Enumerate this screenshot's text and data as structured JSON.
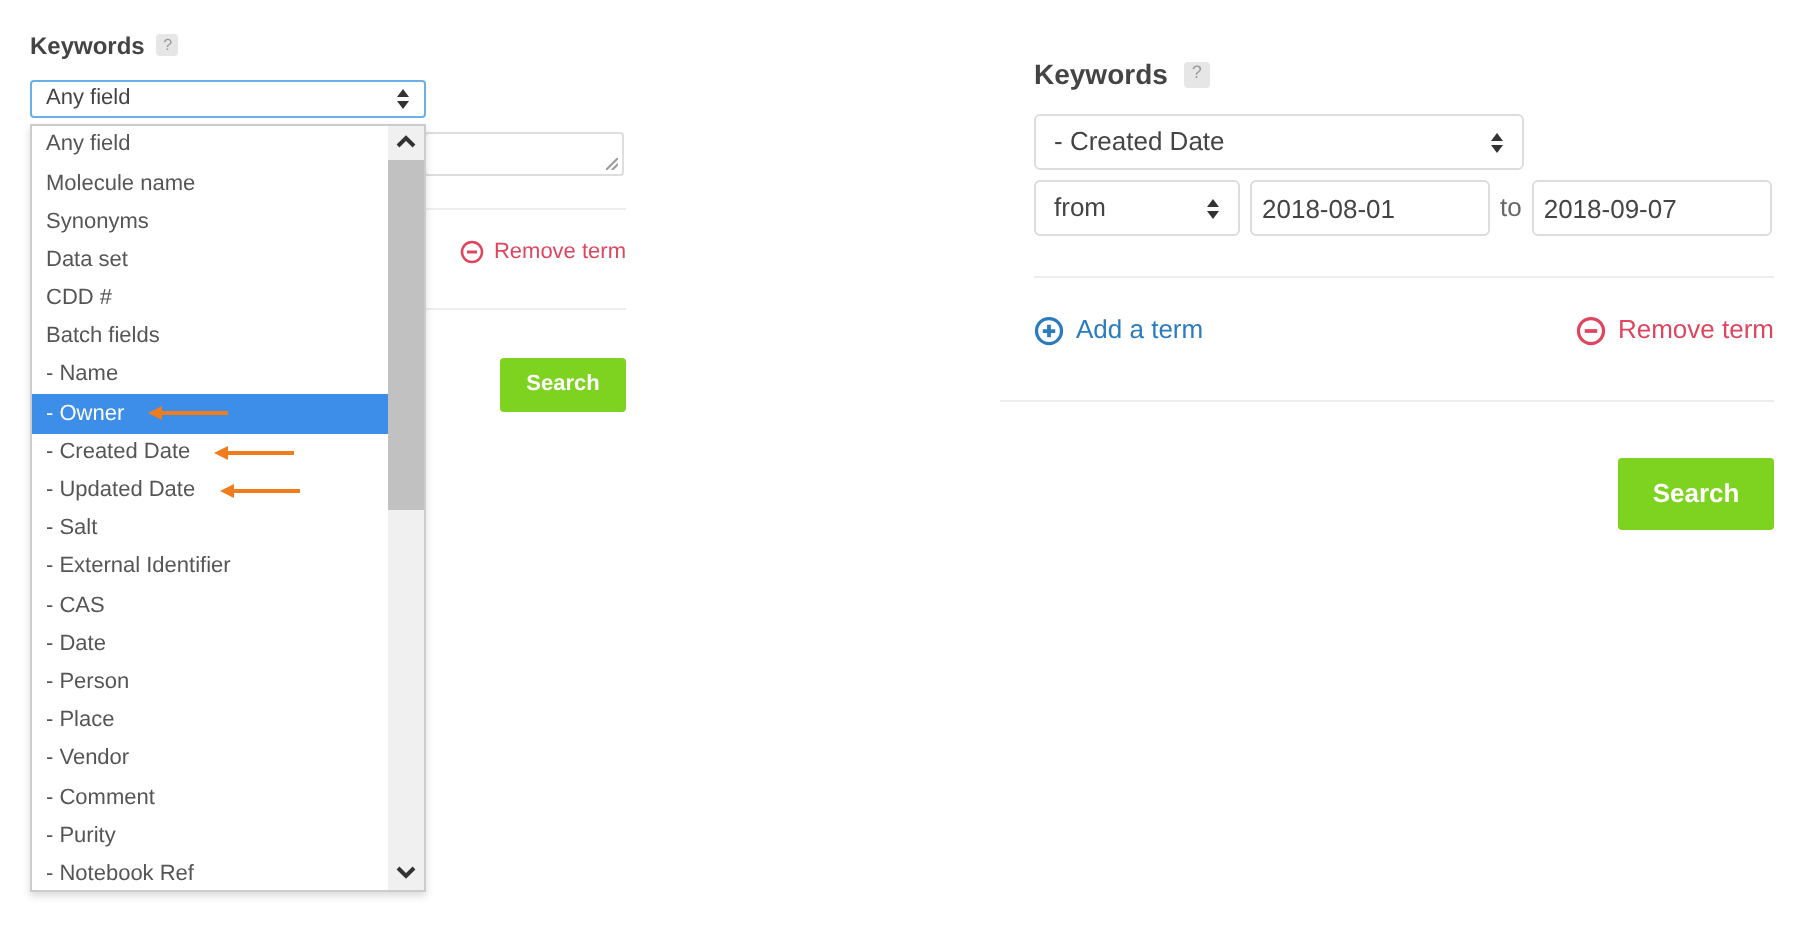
{
  "left_panel": {
    "heading": "Keywords",
    "help": "?",
    "field_select": {
      "value": "Any field"
    },
    "dropdown": {
      "options": [
        {
          "label": "Any field",
          "selected": false,
          "marked": false
        },
        {
          "label": "Molecule name",
          "selected": false,
          "marked": false
        },
        {
          "label": "Synonyms",
          "selected": false,
          "marked": false
        },
        {
          "label": "Data set",
          "selected": false,
          "marked": false
        },
        {
          "label": "CDD #",
          "selected": false,
          "marked": false
        },
        {
          "label": "Batch fields",
          "selected": false,
          "marked": false
        },
        {
          "label": "- Name",
          "selected": false,
          "marked": false
        },
        {
          "label": "- Owner",
          "selected": true,
          "marked": true
        },
        {
          "label": "- Created Date",
          "selected": false,
          "marked": true
        },
        {
          "label": "- Updated Date",
          "selected": false,
          "marked": true
        },
        {
          "label": "- Salt",
          "selected": false,
          "marked": false
        },
        {
          "label": "- External Identifier",
          "selected": false,
          "marked": false
        },
        {
          "label": "- CAS",
          "selected": false,
          "marked": false
        },
        {
          "label": "- Date",
          "selected": false,
          "marked": false
        },
        {
          "label": "- Person",
          "selected": false,
          "marked": false
        },
        {
          "label": "- Place",
          "selected": false,
          "marked": false
        },
        {
          "label": "- Vendor",
          "selected": false,
          "marked": false
        },
        {
          "label": "- Comment",
          "selected": false,
          "marked": false
        },
        {
          "label": "- Purity",
          "selected": false,
          "marked": false
        },
        {
          "label": "- Notebook Ref",
          "selected": false,
          "marked": false
        }
      ]
    },
    "remove_term": "Remove term",
    "search_button": "Search"
  },
  "right_panel": {
    "heading": "Keywords",
    "help": "?",
    "field_select": {
      "value": "- Created Date"
    },
    "operator_select": {
      "value": "from"
    },
    "from_date": {
      "value": "2018-08-01"
    },
    "to_label": "to",
    "to_date": {
      "value": "2018-09-07"
    },
    "add_term": "Add a term",
    "remove_term": "Remove term",
    "search_button": "Search"
  }
}
